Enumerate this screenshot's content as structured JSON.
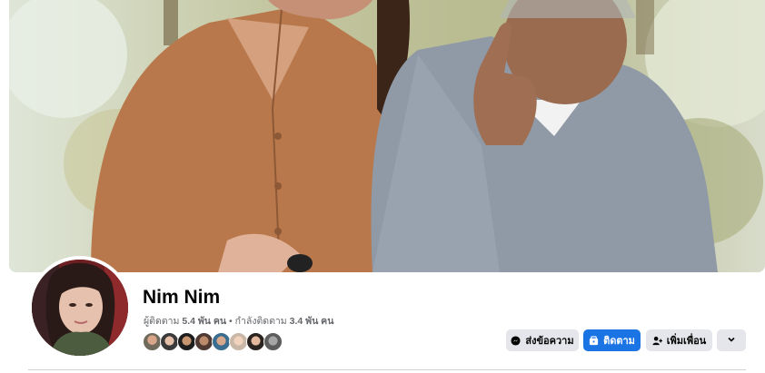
{
  "profile": {
    "name": "Nim Nim",
    "followers_label": "ผู้ติดตาม",
    "followers_count": "5.4 พัน คน",
    "separator": "•",
    "following_label": "กำลังติดตาม",
    "following_count": "3.4 พัน คน",
    "friend_avatars": 9
  },
  "actions": {
    "message_label": "ส่งข้อความ",
    "follow_label": "ติดตาม",
    "add_friend_label": "เพิ่มเพื่อน",
    "more_icon": "chevron-down-icon"
  },
  "colors": {
    "primary_button": "#1b74e4",
    "secondary_button": "#e4e6eb",
    "secondary_text": "#65676b"
  }
}
